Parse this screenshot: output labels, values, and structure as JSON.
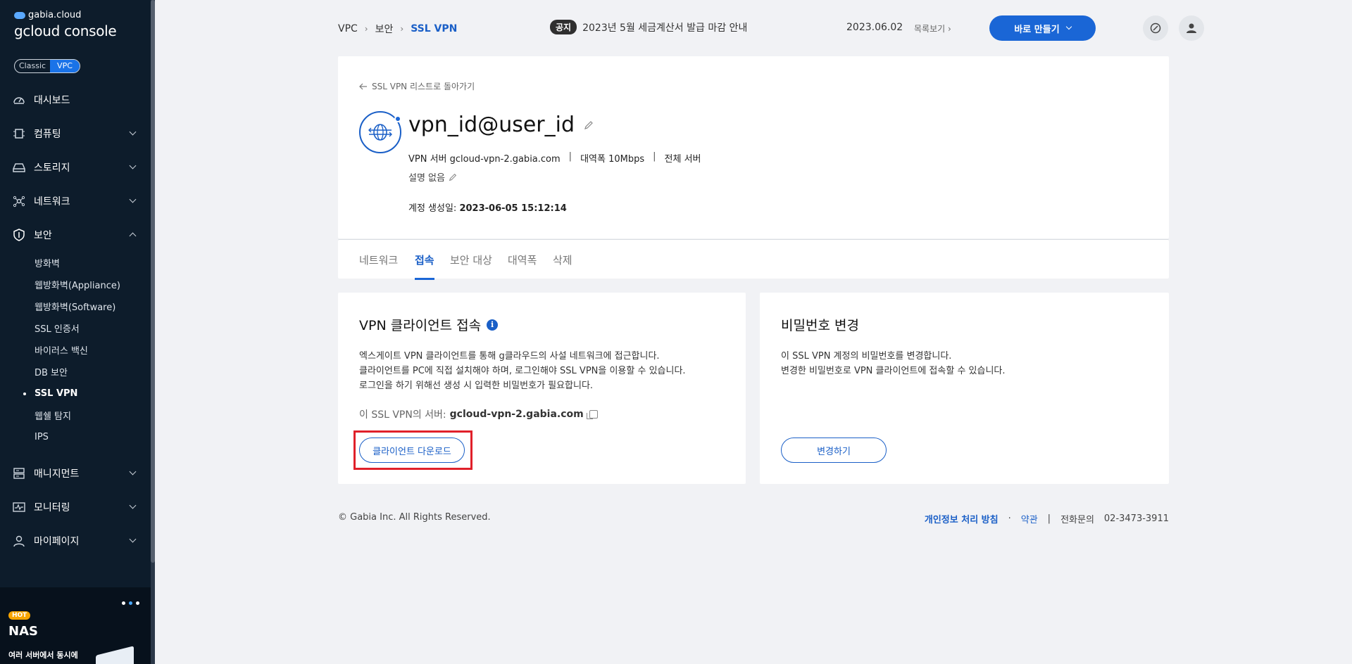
{
  "sidebar": {
    "brand": "gabia.cloud",
    "title": "gcloud console",
    "mode_classic": "Classic",
    "mode_vpc": "VPC",
    "items": [
      {
        "label": "대시보드"
      },
      {
        "label": "컴퓨팅"
      },
      {
        "label": "스토리지"
      },
      {
        "label": "네트워크"
      },
      {
        "label": "보안"
      },
      {
        "label": "매니지먼트"
      },
      {
        "label": "모니터링"
      },
      {
        "label": "마이페이지"
      }
    ],
    "security_sub": [
      "방화벽",
      "웹방화벽(Appliance)",
      "웹방화벽(Software)",
      "SSL 인증서",
      "바이러스 백신",
      "DB 보안",
      "SSL VPN",
      "웹쉘 탐지",
      "IPS"
    ],
    "banner": {
      "badge": "HOT",
      "name": "NAS",
      "desc": "여러 서버에서 동시에"
    }
  },
  "topbar": {
    "breadcrumb": [
      "VPC",
      "보안",
      "SSL VPN"
    ],
    "notice_tag": "공지",
    "notice_text": "2023년 5월 세금계산서 발급 마감 안내",
    "date": "2023.06.02",
    "list_link": "목록보기",
    "create_button": "바로 만들기"
  },
  "detail": {
    "back_link": "SSL VPN 리스트로 돌아가기",
    "name": "vpn_id@user_id",
    "server_label": "VPN 서버 gcloud-vpn-2.gabia.com",
    "bandwidth": "대역폭 10Mbps",
    "target": "전체 서버",
    "description": "설명 없음",
    "created_label": "계정 생성일:",
    "created_value": "2023-06-05 15:12:14"
  },
  "tabs": [
    "네트워크",
    "접속",
    "보안 대상",
    "대역폭",
    "삭제"
  ],
  "vpn_client": {
    "title": "VPN 클라이언트 접속",
    "lines": [
      "엑스게이트 VPN 클라이언트를 통해 g클라우드의 사설 네트워크에 접근합니다.",
      "클라이언트를 PC에 직접 설치해야 하며, 로그인해야 SSL VPN을 이용할 수 있습니다.",
      "로그인을 하기 위해선 생성 시 입력한 비밀번호가 필요합니다."
    ],
    "server_label": "이 SSL VPN의 서버:",
    "server_value": "gcloud-vpn-2.gabia.com",
    "download_button": "클라이언트 다운로드"
  },
  "password": {
    "title": "비밀번호 변경",
    "lines": [
      "이 SSL VPN 계정의 비밀번호를 변경합니다.",
      "변경한 비밀번호로 VPN 클라이언트에 접속할 수 있습니다."
    ],
    "change_button": "변경하기"
  },
  "footer": {
    "copyright": "© Gabia Inc. All Rights Reserved.",
    "privacy": "개인정보 처리 방침",
    "dot": "·",
    "terms": "약관",
    "bar": "|",
    "phone_label": "전화문의",
    "phone": "02-3473-3911"
  },
  "colors": {
    "sidebar_bg": "#0d1c2b",
    "accent": "#1a66d6",
    "highlight": "#e0202a"
  }
}
